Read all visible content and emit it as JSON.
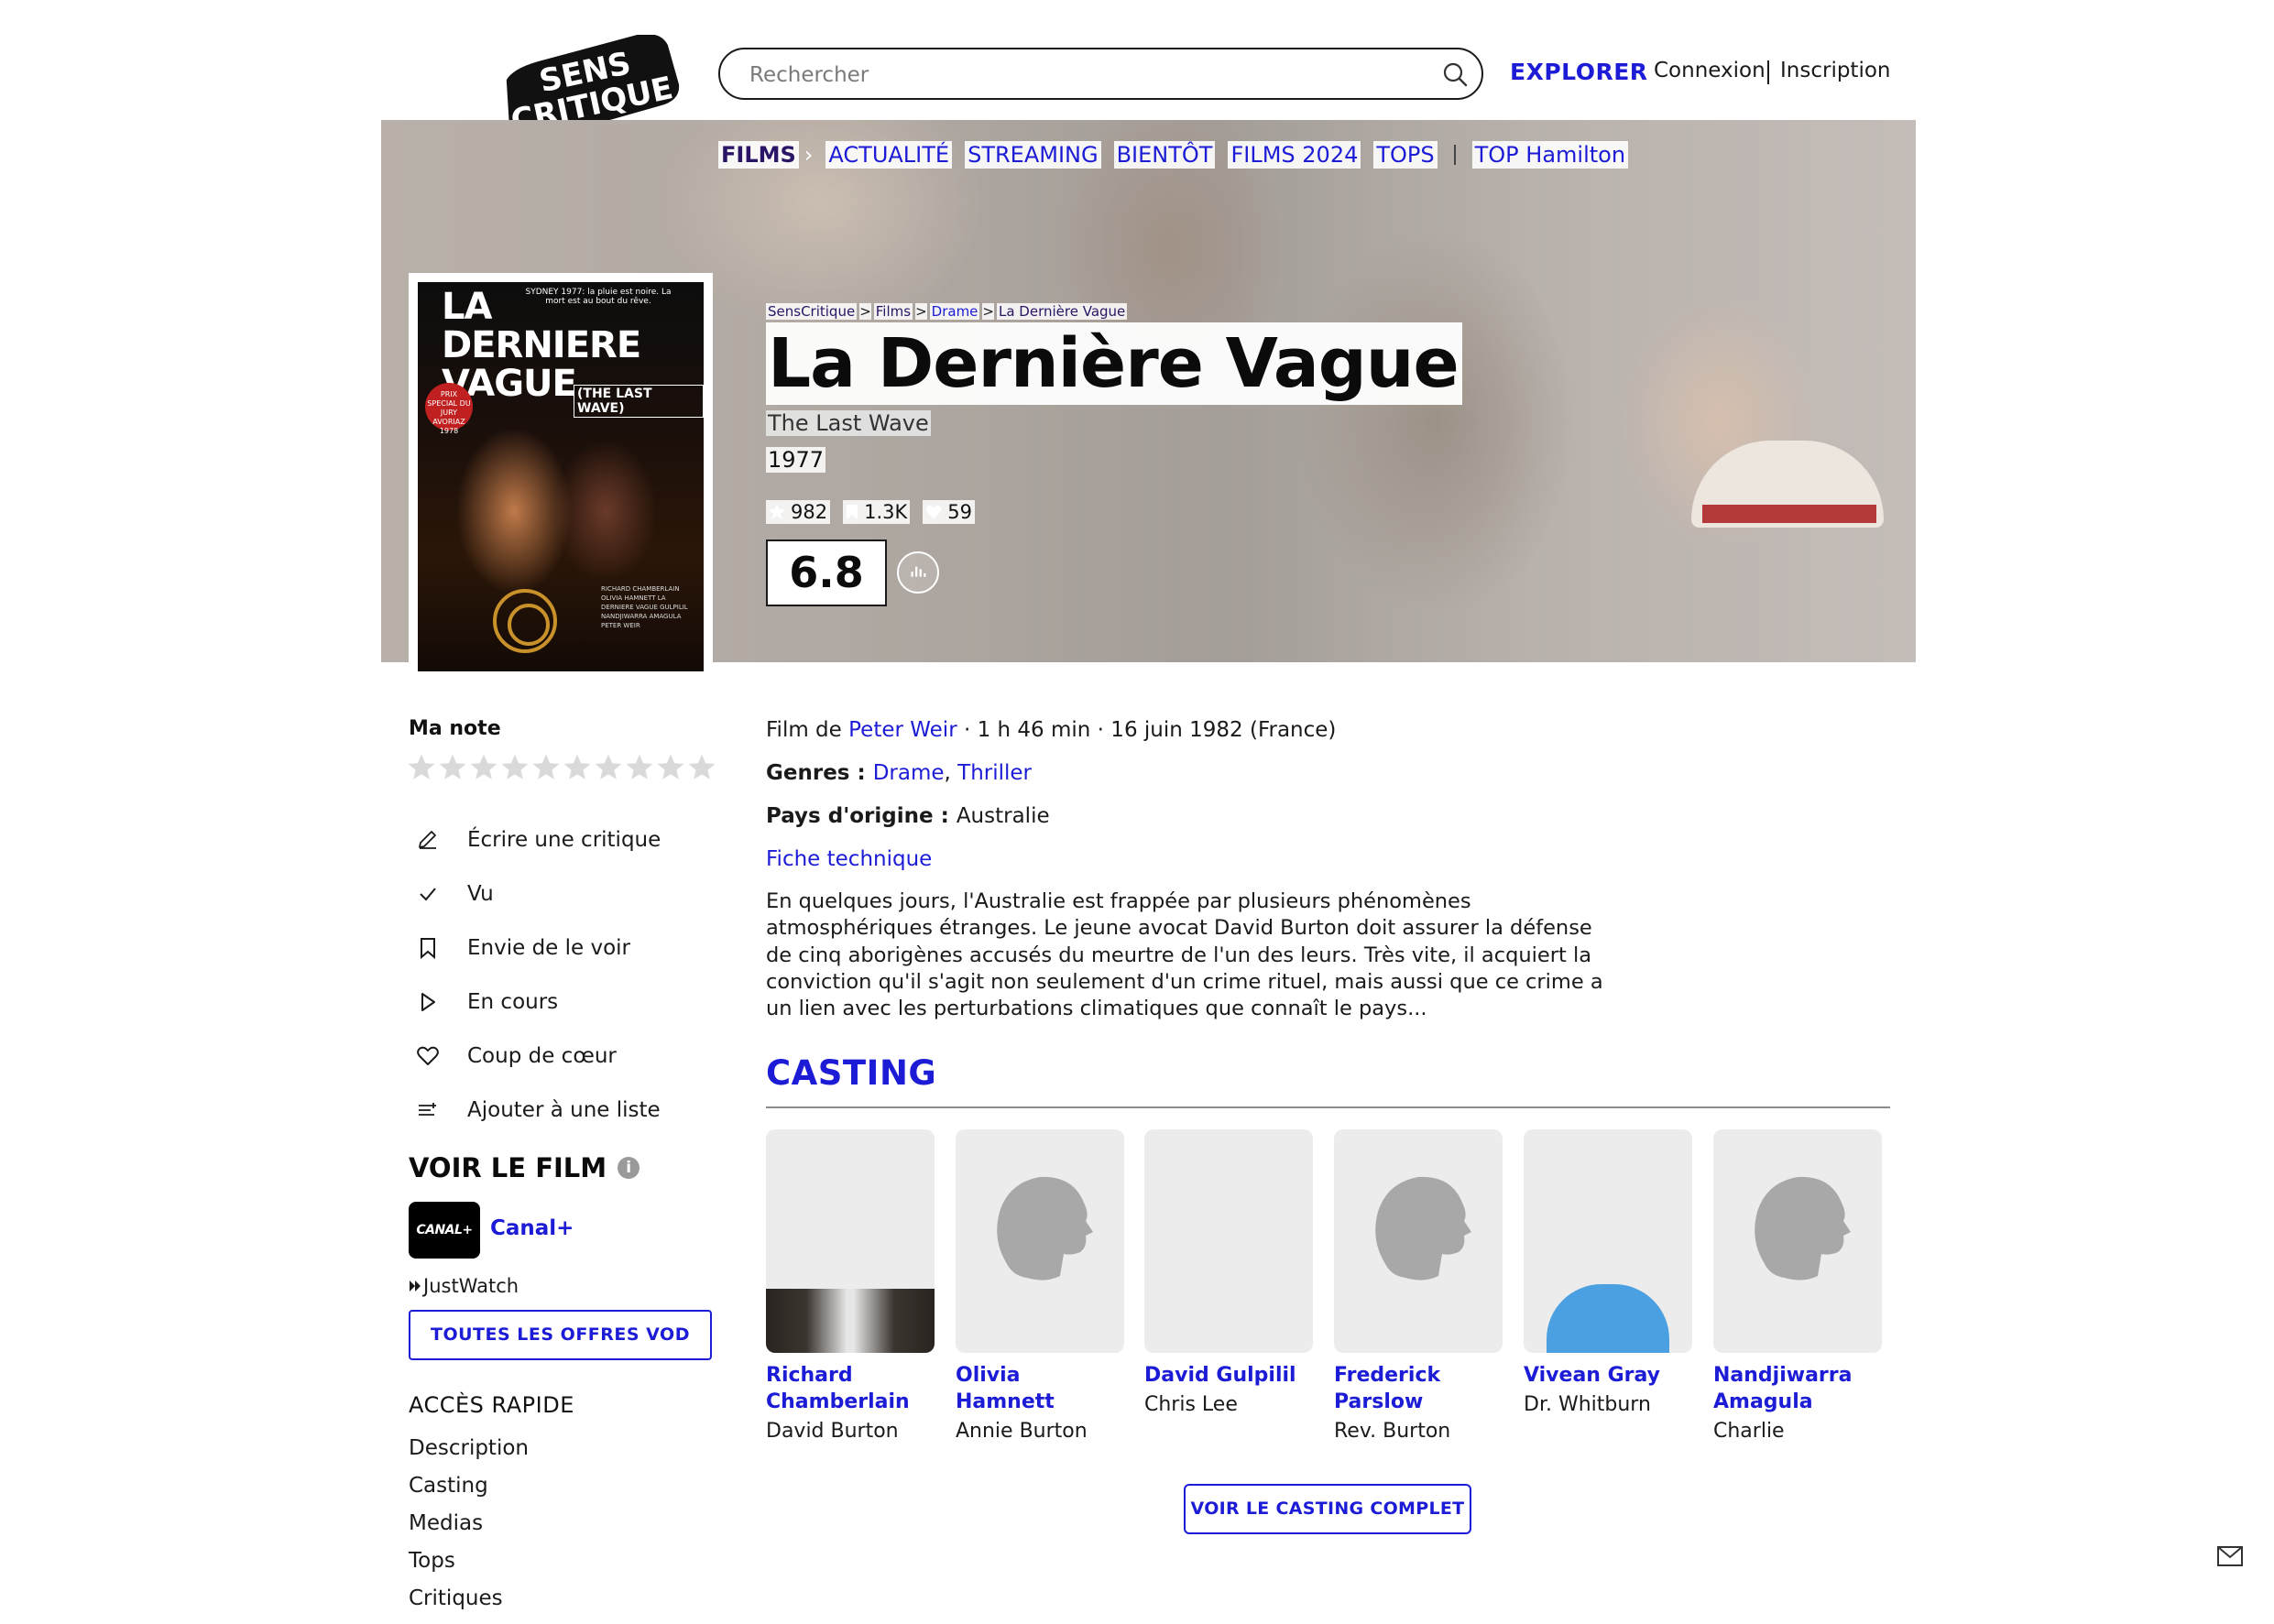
{
  "header": {
    "logo_text": "SENS CRITIQUE",
    "search_placeholder": "Rechercher",
    "explorer": "EXPLORER",
    "connexion": "Connexion",
    "inscription": "Inscription"
  },
  "nav": {
    "films": "FILMS",
    "items": [
      "ACTUALITÉ",
      "STREAMING",
      "BIENTÔT",
      "FILMS 2024",
      "TOPS"
    ],
    "top": "TOP Hamilton"
  },
  "breadcrumb": [
    "SensCritique",
    "Films",
    "Drame",
    "La Dernière Vague"
  ],
  "movie": {
    "title": "La Dernière Vague",
    "original_title": "The Last Wave",
    "year": "1977",
    "stats": {
      "ratings": "982",
      "wishlist": "1.3K",
      "favorites": "59"
    },
    "score": "6.8",
    "info": {
      "prefix": "Film de ",
      "director": "Peter Weir",
      "details": " · 1 h 46 min · 16 juin 1982 (France)"
    },
    "genres_label": "Genres : ",
    "genres": [
      "Drame",
      "Thriller"
    ],
    "country_label": "Pays d'origine : ",
    "country": "Australie",
    "fiche": "Fiche technique",
    "synopsis": "En quelques jours, l'Australie est frappée par plusieurs phénomènes atmosphériques étranges. Le jeune avocat David Burton doit assurer la défense de cinq aborigènes accusés du meurtre de l'un des leurs. Très vite, il acquiert la conviction qu'il s'agit non seulement d'un crime rituel, mais aussi que ce crime a un lien avec les perturbations climatiques que connaît le pays..."
  },
  "poster": {
    "title_line1": "LA",
    "title_line2": "DERNIERE",
    "title_line3": "VAGUE",
    "subtitle": "(THE LAST WAVE)",
    "tagline": "SYDNEY 1977: la pluie est noire. La mort est au bout du rêve.",
    "badge": "PRIX SPECIAL DU JURY AVORIAZ 1978",
    "credits": "RICHARD CHAMBERLAIN OLIVIA HAMNETT LA DERNIERE VAGUE GULPILIL NANDJIWARRA AMAGULA PETER WEIR"
  },
  "sidebar": {
    "ma_note": "Ma note",
    "star_count": 10,
    "actions": [
      {
        "label": "Écrire une critique",
        "icon": "pencil-icon"
      },
      {
        "label": "Vu",
        "icon": "check-icon"
      },
      {
        "label": "Envie de le voir",
        "icon": "bookmark-icon"
      },
      {
        "label": "En cours",
        "icon": "play-icon"
      },
      {
        "label": "Coup de cœur",
        "icon": "heart-icon"
      },
      {
        "label": "Ajouter à une liste",
        "icon": "list-add-icon"
      }
    ],
    "voir_le_film": "VOIR LE FILM",
    "info_glyph": "i",
    "provider_logo": "CANAL+",
    "provider": "Canal+",
    "justwatch": "JustWatch",
    "vod_button": "TOUTES LES OFFRES VOD",
    "acces_rapide": "ACCÈS RAPIDE",
    "quick_links": [
      "Description",
      "Casting",
      "Medias",
      "Tops",
      "Critiques"
    ]
  },
  "casting": {
    "heading": "CASTING",
    "members": [
      {
        "name": "Richard Chamberlain",
        "role": "David Burton",
        "photo": "photo"
      },
      {
        "name": "Olivia Hamnett",
        "role": "Annie Burton",
        "photo": "placeholder"
      },
      {
        "name": "David Gulpilil",
        "role": "Chris Lee",
        "photo": "photo"
      },
      {
        "name": "Frederick Parslow",
        "role": "Rev. Burton",
        "photo": "placeholder"
      },
      {
        "name": "Vivean Gray",
        "role": "Dr. Whitburn",
        "photo": "photo"
      },
      {
        "name": "Nandjiwarra Amagula",
        "role": "Charlie",
        "photo": "placeholder"
      }
    ],
    "button": "VOIR LE CASTING COMPLET"
  },
  "colors": {
    "accent": "#1c1cd6",
    "nav_films": "#2b1566",
    "text": "#1a1a1a"
  }
}
